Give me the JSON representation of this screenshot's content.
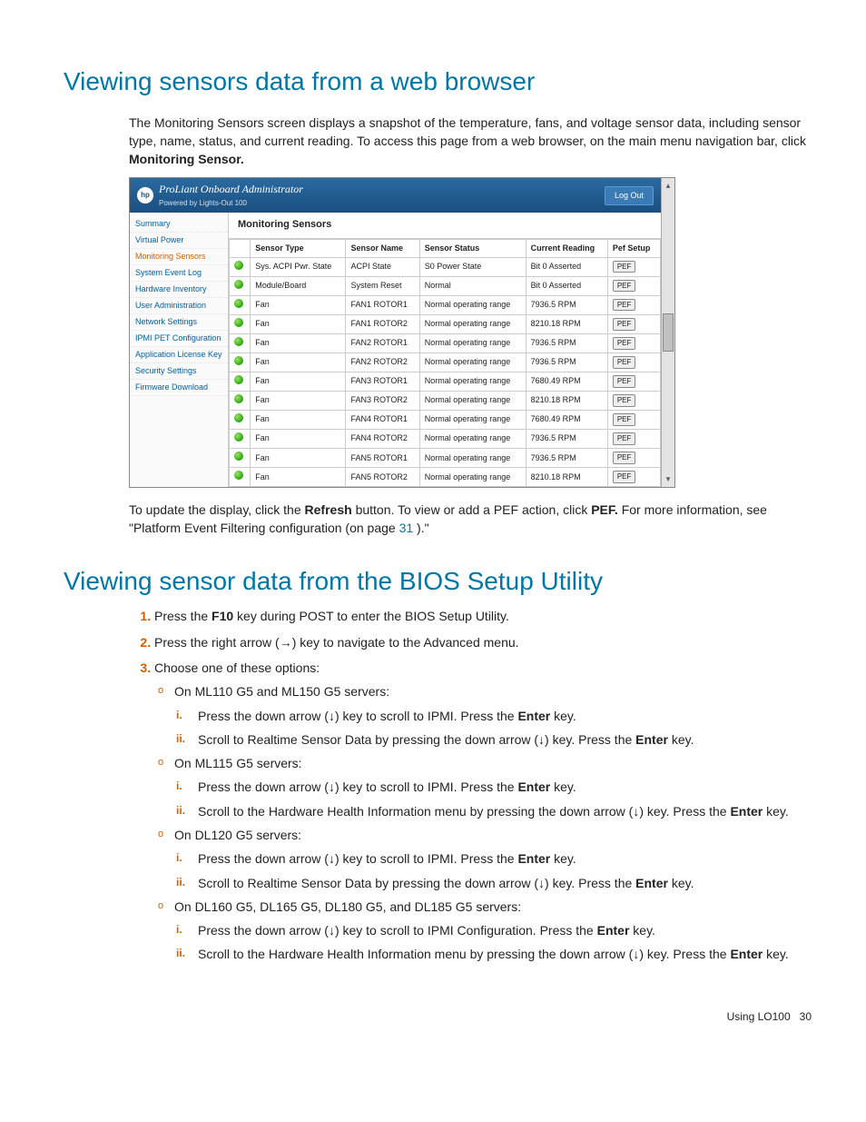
{
  "section1": {
    "heading": "Viewing sensors data from a web browser",
    "intro_a": "The Monitoring Sensors screen displays a snapshot of the temperature, fans, and voltage sensor data, including sensor type, name, status, and current reading. To access this page from a web browser, on the main menu navigation bar, click ",
    "intro_bold": "Monitoring Sensor.",
    "after_a": "To update the display, click the ",
    "after_b1": "Refresh",
    "after_c": " button. To view or add a PEF action, click ",
    "after_b2": "PEF.",
    "after_d": " For more information, see \"Platform Event Filtering configuration (on page ",
    "after_link": "31",
    "after_e": ").\""
  },
  "shot": {
    "product": "ProLiant Onboard Administrator",
    "sub": "Powered by Lights-Out 100",
    "logout": "Log Out",
    "nav": [
      "Summary",
      "Virtual Power",
      "Monitoring Sensors",
      "System Event Log",
      "Hardware Inventory",
      "User Administration",
      "Network Settings",
      "IPMI PET Configuration",
      "Application License Key",
      "Security Settings",
      "Firmware Download"
    ],
    "nav_active_index": 2,
    "panel_title": "Monitoring Sensors",
    "headers": [
      "",
      "Sensor Type",
      "Sensor Name",
      "Sensor Status",
      "Current Reading",
      "Pef Setup"
    ],
    "pef_label": "PEF",
    "rows": [
      {
        "type": "Sys. ACPI Pwr. State",
        "name": "ACPI State",
        "status": "S0 Power State",
        "reading": "Bit 0 Asserted"
      },
      {
        "type": "Module/Board",
        "name": "System Reset",
        "status": "Normal",
        "reading": "Bit 0 Asserted"
      },
      {
        "type": "Fan",
        "name": "FAN1 ROTOR1",
        "status": "Normal operating range",
        "reading": "7936.5 RPM"
      },
      {
        "type": "Fan",
        "name": "FAN1 ROTOR2",
        "status": "Normal operating range",
        "reading": "8210.18 RPM"
      },
      {
        "type": "Fan",
        "name": "FAN2 ROTOR1",
        "status": "Normal operating range",
        "reading": "7936.5 RPM"
      },
      {
        "type": "Fan",
        "name": "FAN2 ROTOR2",
        "status": "Normal operating range",
        "reading": "7936.5 RPM"
      },
      {
        "type": "Fan",
        "name": "FAN3 ROTOR1",
        "status": "Normal operating range",
        "reading": "7680.49 RPM"
      },
      {
        "type": "Fan",
        "name": "FAN3 ROTOR2",
        "status": "Normal operating range",
        "reading": "8210.18 RPM"
      },
      {
        "type": "Fan",
        "name": "FAN4 ROTOR1",
        "status": "Normal operating range",
        "reading": "7680.49 RPM"
      },
      {
        "type": "Fan",
        "name": "FAN4 ROTOR2",
        "status": "Normal operating range",
        "reading": "7936.5 RPM"
      },
      {
        "type": "Fan",
        "name": "FAN5 ROTOR1",
        "status": "Normal operating range",
        "reading": "7936.5 RPM"
      },
      {
        "type": "Fan",
        "name": "FAN5 ROTOR2",
        "status": "Normal operating range",
        "reading": "8210.18 RPM"
      }
    ]
  },
  "section2": {
    "heading": "Viewing sensor data from the BIOS Setup Utility",
    "step1_a": "Press the ",
    "step1_b": "F10",
    "step1_c": " key during POST to enter the BIOS Setup Utility.",
    "step2": "Press the right arrow (→) key to navigate to the Advanced menu.",
    "step3": "Choose one of these options:",
    "opts": [
      {
        "label": "On ML110 G5 and ML150 G5 servers:",
        "sub": [
          {
            "a": "Press the down arrow (↓) key to scroll to IPMI. Press the ",
            "b": "Enter",
            "c": " key."
          },
          {
            "a": "Scroll to Realtime Sensor Data by pressing the down arrow (↓) key. Press the ",
            "b": "Enter",
            "c": " key."
          }
        ]
      },
      {
        "label": "On ML115 G5 servers:",
        "sub": [
          {
            "a": "Press the down arrow (↓) key to scroll to IPMI. Press the ",
            "b": "Enter",
            "c": " key."
          },
          {
            "a": "Scroll to the Hardware Health Information menu by pressing the down arrow (↓) key. Press the ",
            "b": "Enter",
            "c": " key."
          }
        ]
      },
      {
        "label": "On DL120 G5 servers:",
        "sub": [
          {
            "a": "Press the down arrow (↓) key to scroll to IPMI. Press the ",
            "b": "Enter",
            "c": " key."
          },
          {
            "a": "Scroll to Realtime Sensor Data by pressing the down arrow (↓) key. Press the ",
            "b": "Enter",
            "c": " key."
          }
        ]
      },
      {
        "label": "On DL160 G5, DL165 G5, DL180 G5, and DL185 G5 servers:",
        "sub": [
          {
            "a": "Press the down arrow (↓) key to scroll to IPMI Configuration. Press the ",
            "b": "Enter",
            "c": " key."
          },
          {
            "a": "Scroll to the Hardware Health Information menu by pressing the down arrow (↓) key. Press the ",
            "b": "Enter",
            "c": " key."
          }
        ]
      }
    ]
  },
  "footer": {
    "label": "Using LO100",
    "page": "30"
  }
}
